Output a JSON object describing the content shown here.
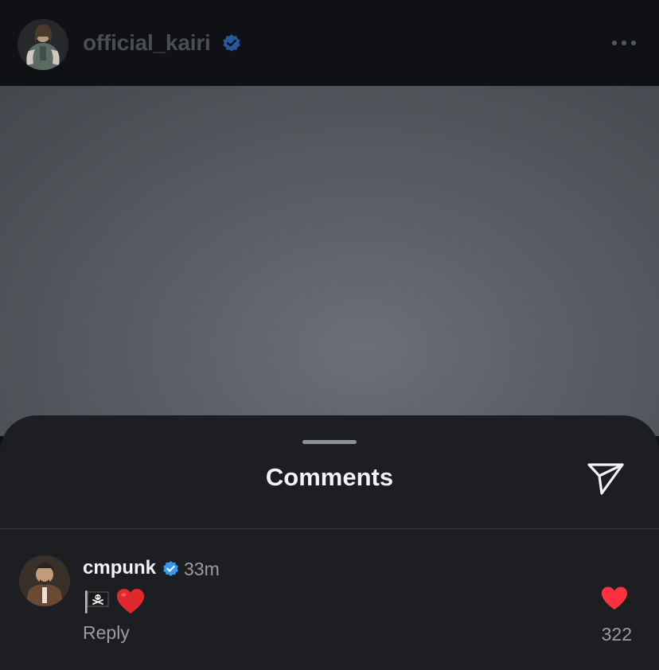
{
  "header": {
    "username": "official_kairi",
    "verified": true
  },
  "comments_sheet": {
    "title": "Comments"
  },
  "comments": [
    {
      "username": "cmpunk",
      "verified": true,
      "time": "33m",
      "text_emojis": [
        "pirate-flag",
        "red-heart"
      ],
      "reply_label": "Reply",
      "like_count": "322"
    }
  ],
  "colors": {
    "verified_blue": "#3897f0",
    "heart_red": "#ff3040",
    "sheet_bg": "#1c1e22"
  }
}
